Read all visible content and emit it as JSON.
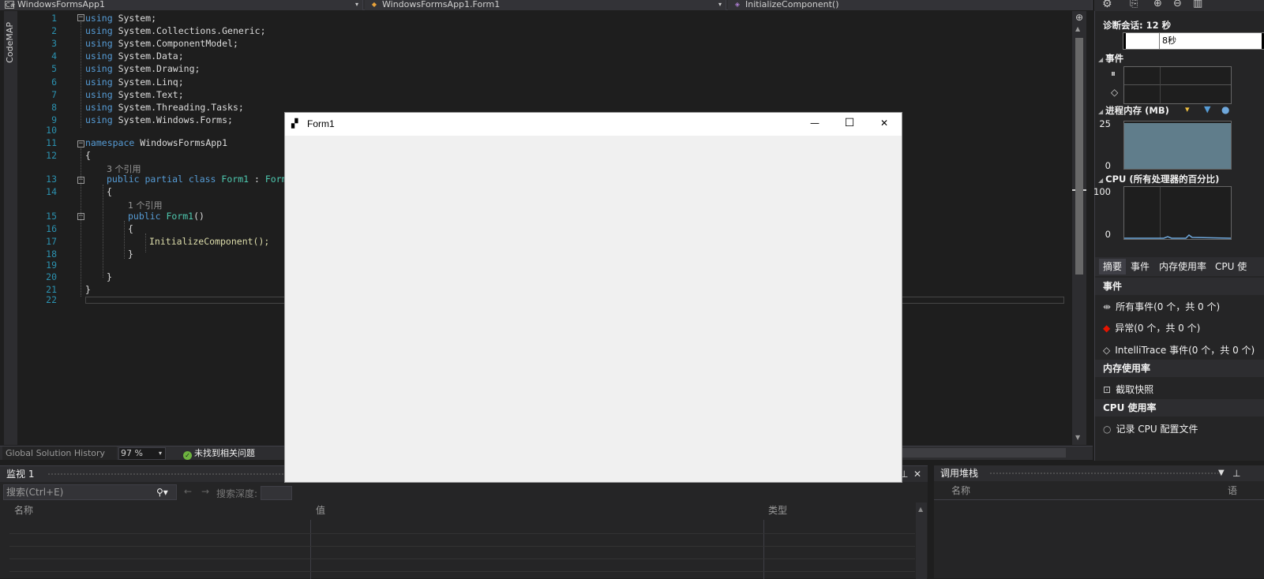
{
  "nav": {
    "project": "WindowsFormsApp1",
    "class": "WindowsFormsApp1.Form1",
    "member": "InitializeComponent()"
  },
  "codemap": "CodeMAP",
  "code": {
    "lines": [
      "1",
      "2",
      "3",
      "4",
      "5",
      "6",
      "7",
      "8",
      "9",
      "10",
      "11",
      "12",
      "13",
      "14",
      "15",
      "16",
      "17",
      "18",
      "19",
      "20",
      "21",
      "22"
    ],
    "using_kw": "using",
    "usings": [
      "System;",
      "System.Collections.Generic;",
      "System.ComponentModel;",
      "System.Data;",
      "System.Drawing;",
      "System.Linq;",
      "System.Text;",
      "System.Threading.Tasks;",
      "System.Windows.Forms;"
    ],
    "namespace_kw": "namespace",
    "namespace_name": "WindowsFormsApp1",
    "ref3": "3 个引用",
    "ref1": "1 个引用",
    "class_decl": {
      "mods": "public partial class",
      "name": "Form1",
      "sep": " : ",
      "base": "Form"
    },
    "ctor": {
      "mod": "public",
      "name": "Form1",
      "parens": "()"
    },
    "call": "InitializeComponent();",
    "open_brace": "{",
    "close_brace": "}"
  },
  "status": {
    "history": "Global Solution History",
    "zoom": "97 %",
    "issues": "未找到相关问题"
  },
  "form": {
    "title": "Form1",
    "minimize": "—",
    "maximize": "☐",
    "close": "✕"
  },
  "diag": {
    "session": "诊断会话: 12 秒",
    "timeline_label": "8秒",
    "events_title": "事件",
    "memory_title": "进程内存 (MB)",
    "mem_max": "25",
    "mem_min": "0",
    "cpu_title": "CPU (所有处理器的百分比)",
    "cpu_max": "100",
    "cpu_min": "0",
    "tabs": [
      "摘要",
      "事件",
      "内存使用率",
      "CPU 使"
    ],
    "section_events": "事件",
    "all_events": "所有事件(0 个，共 0 个)",
    "exceptions": "异常(0 个，共 0 个)",
    "intellitrace": "IntelliTrace 事件(0 个，共 0 个)",
    "section_memory": "内存使用率",
    "snapshot": "截取快照",
    "section_cpu": "CPU 使用率",
    "record_cpu": "记录 CPU 配置文件",
    "colors": {
      "memory_fill": "#607d8b",
      "accent": "#569cd6"
    }
  },
  "watch": {
    "title": "监视 1",
    "search_placeholder": "搜索(Ctrl+E)",
    "depth_label": "搜索深度:",
    "cols": [
      "名称",
      "值",
      "类型"
    ]
  },
  "callstack": {
    "title": "调用堆栈",
    "cols": [
      "名称",
      "语"
    ]
  }
}
